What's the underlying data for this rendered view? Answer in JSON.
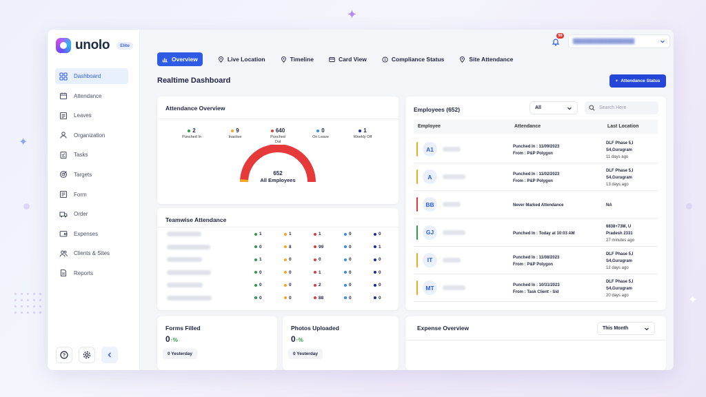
{
  "app": {
    "name": "unolo",
    "plan_badge": "Elite"
  },
  "sidebar": {
    "items": [
      {
        "label": "Dashboard",
        "icon": "grid-icon",
        "active": true
      },
      {
        "label": "Attendance",
        "icon": "calendar-icon"
      },
      {
        "label": "Leaves",
        "icon": "leaves-icon"
      },
      {
        "label": "Organization",
        "icon": "user-icon"
      },
      {
        "label": "Tasks",
        "icon": "tasks-icon"
      },
      {
        "label": "Targets",
        "icon": "target-icon"
      },
      {
        "label": "Form",
        "icon": "form-icon"
      },
      {
        "label": "Order",
        "icon": "truck-icon"
      },
      {
        "label": "Expenses",
        "icon": "wallet-icon"
      },
      {
        "label": "Clients & Sites",
        "icon": "users-icon"
      },
      {
        "label": "Reports",
        "icon": "reports-icon"
      }
    ]
  },
  "header": {
    "notification_count": "99"
  },
  "tabs": [
    {
      "label": "Overview",
      "icon": "chart-icon",
      "active": true
    },
    {
      "label": "Live Location",
      "icon": "pin-icon"
    },
    {
      "label": "Timeline",
      "icon": "pin-icon"
    },
    {
      "label": "Card View",
      "icon": "card-icon"
    },
    {
      "label": "Compliance Status",
      "icon": "info-icon"
    },
    {
      "label": "Site Attendance",
      "icon": "pin-icon"
    }
  ],
  "page": {
    "title": "Realtime Dashboard",
    "action_button": "Attendance Status"
  },
  "attendance_overview": {
    "title": "Attendance Overview",
    "stats": [
      {
        "value": "2",
        "label": "Punched In",
        "color": "#2e9c46"
      },
      {
        "value": "9",
        "label": "Inactive",
        "color": "#f5a623"
      },
      {
        "value": "640",
        "label": "Punched Out",
        "color": "#e53935"
      },
      {
        "value": "0",
        "label": "On Leave",
        "color": "#2d8ef0"
      },
      {
        "value": "1",
        "label": "Weekly Off",
        "color": "#1a2a9c"
      }
    ],
    "total": "652",
    "total_label": "All Employees"
  },
  "teamwise": {
    "title": "Teamwise Attendance",
    "colors": [
      "#2e9c46",
      "#f5a623",
      "#e53935",
      "#2d8ef0",
      "#1a2a9c"
    ],
    "rows": [
      [
        "1",
        "1",
        "1",
        "0",
        "0"
      ],
      [
        "0",
        "8",
        "99",
        "0",
        "1"
      ],
      [
        "1",
        "0",
        "0",
        "0",
        "0"
      ],
      [
        "0",
        "0",
        "1",
        "0",
        "0"
      ],
      [
        "0",
        "0",
        "2",
        "0",
        "0"
      ],
      [
        "0",
        "0",
        "88",
        "0",
        "0"
      ]
    ]
  },
  "employees": {
    "title": "Employees (652)",
    "filter": "All",
    "search_placeholder": "Search Here",
    "columns": [
      "Employee",
      "Attendance",
      "Last Location"
    ],
    "rows": [
      {
        "initials": "A1",
        "bar": "#f5a623",
        "att1": "Punched In : 11/09/2023",
        "att2": "From : P&P Polygon",
        "loc1": "DLF Phase 5,I",
        "loc2": "S4,Gurugram",
        "ago": "11 days ago"
      },
      {
        "initials": "A",
        "bar": "#f5a623",
        "att1": "Punched In : 11/02/2023",
        "att2": "From : P&P Polygon",
        "loc1": "DLF Phase 5,I",
        "loc2": "S4,Gurugram",
        "ago": "13 days ago"
      },
      {
        "initials": "BB",
        "bar": "#e53935",
        "att1": "Never Marked Attendance",
        "att2": "",
        "loc1": "NA",
        "loc2": "",
        "ago": ""
      },
      {
        "initials": "GJ",
        "bar": "#2e9c46",
        "att1": "Punched In : Today at 10:03 AM",
        "att2": "",
        "loc1": "6838+73M, U",
        "loc2": "Pradesh 2331",
        "ago": "27 minutes ago"
      },
      {
        "initials": "IT",
        "bar": "#f5a623",
        "att1": "Punched In : 11/08/2023",
        "att2": "From : P&P Polygon",
        "loc1": "DLF Phase 5,I",
        "loc2": "S4,Gurugram",
        "ago": "12 days ago"
      },
      {
        "initials": "MT",
        "bar": "#f5a623",
        "att1": "Punched In : 10/31/2023",
        "att2": "From : Task Client - Sid",
        "loc1": "DLF Phase 5,I",
        "loc2": "S4,Gurugram",
        "ago": "20 days ago"
      }
    ]
  },
  "forms_filled": {
    "title": "Forms Filled",
    "value": "0",
    "pct": "↑%",
    "yesterday": "0 Yesterday"
  },
  "photos_uploaded": {
    "title": "Photos Uploaded",
    "value": "0",
    "pct": "↑%",
    "yesterday": "0 Yesterday"
  },
  "expense_overview": {
    "title": "Expense Overview",
    "period": "This Month"
  }
}
